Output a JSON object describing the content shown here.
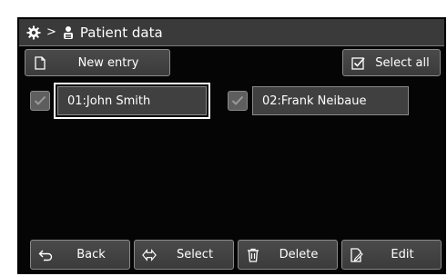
{
  "header": {
    "settings_icon": "gear-icon",
    "separator": ">",
    "patient_icon": "patient-icon",
    "title": "Patient data"
  },
  "toolbar": {
    "new_entry_label": "New entry",
    "select_all_label": "Select all"
  },
  "patients": [
    {
      "label": "01:John Smith",
      "selected": true
    },
    {
      "label": "02:Frank Neibaue",
      "selected": false
    }
  ],
  "footer": {
    "back_label": "Back",
    "select_label": "Select",
    "delete_label": "Delete",
    "edit_label": "Edit"
  }
}
